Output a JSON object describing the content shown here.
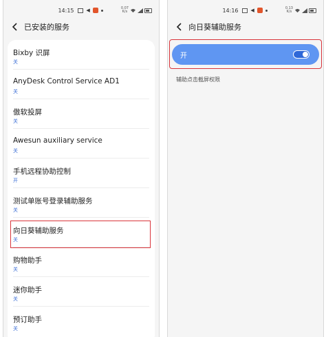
{
  "left_phone": {
    "status": {
      "time": "14:15",
      "net": "0.07\nK/s"
    },
    "title": "已安装的服务",
    "items": [
      {
        "title": "Bixby 识屏",
        "state": "关"
      },
      {
        "title": "AnyDesk Control Service AD1",
        "state": "关"
      },
      {
        "title": "傲软投屏",
        "state": "关"
      },
      {
        "title": "Awesun auxiliary service",
        "state": "关"
      },
      {
        "title": "手机远程协助控制",
        "state": "开"
      },
      {
        "title": "测试单账号登录辅助服务",
        "state": "关"
      },
      {
        "title": "向日葵辅助服务",
        "state": "关"
      },
      {
        "title": "购物助手",
        "state": "关"
      },
      {
        "title": "迷你助手",
        "state": "关"
      },
      {
        "title": "预订助手",
        "state": "关"
      }
    ]
  },
  "right_phone": {
    "status": {
      "time": "14:16",
      "net": "0.13\nK/s"
    },
    "title": "向日葵辅助服务",
    "toggle": {
      "label": "开",
      "on": true,
      "color": "#5f96f2"
    },
    "description": "辅助点击截屏权限"
  },
  "colors": {
    "accent": "#3d6fd6",
    "highlight": "#d9343a"
  }
}
